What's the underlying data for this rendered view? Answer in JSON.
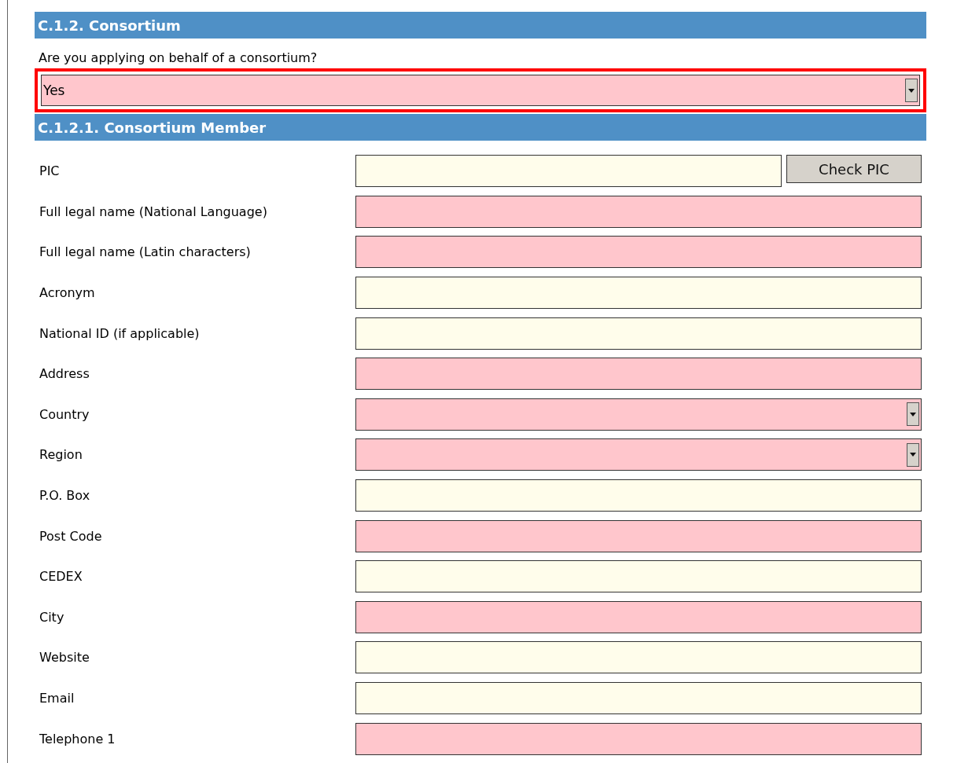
{
  "section": {
    "title": "C.1.2. Consortium"
  },
  "question": {
    "label": "Are you applying on behalf of a consortium?",
    "value": "Yes",
    "required": true,
    "flagged": true
  },
  "subsection": {
    "title": "C.1.2.1. Consortium Member"
  },
  "fields": [
    {
      "label": "PIC",
      "kind": "text",
      "required": false,
      "button": "Check PIC"
    },
    {
      "label": "Full legal name (National Language)",
      "kind": "text",
      "required": true
    },
    {
      "label": "Full legal name (Latin characters)",
      "kind": "text",
      "required": true
    },
    {
      "label": "Acronym",
      "kind": "text",
      "required": false
    },
    {
      "label": "National ID (if applicable)",
      "kind": "text",
      "required": false
    },
    {
      "label": "Address",
      "kind": "text",
      "required": true
    },
    {
      "label": "Country",
      "kind": "select",
      "required": true
    },
    {
      "label": "Region",
      "kind": "select",
      "required": true
    },
    {
      "label": "P.O. Box",
      "kind": "text",
      "required": false
    },
    {
      "label": "Post Code",
      "kind": "text",
      "required": true
    },
    {
      "label": "CEDEX",
      "kind": "text",
      "required": false
    },
    {
      "label": "City",
      "kind": "text",
      "required": true
    },
    {
      "label": "Website",
      "kind": "text",
      "required": false
    },
    {
      "label": "Email",
      "kind": "text",
      "required": false
    },
    {
      "label": "Telephone 1",
      "kind": "text",
      "required": true
    }
  ]
}
